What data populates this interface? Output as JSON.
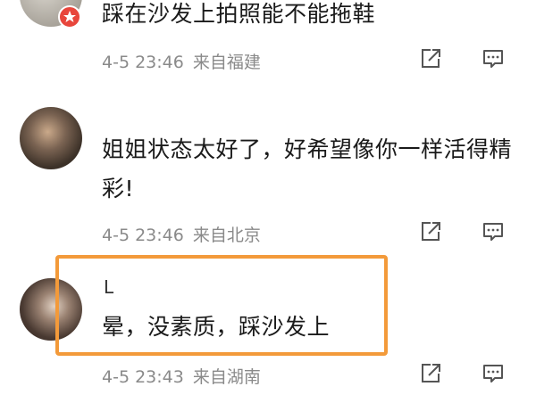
{
  "comments": [
    {
      "text": "踩在沙发上拍照能不能拖鞋",
      "time": "4-5 23:46",
      "location": "来自福建",
      "badge_icon": "star-badge-icon"
    },
    {
      "text_line1": "姐姐状态太好了，好希望像你一样活得精",
      "text_line2": "彩!",
      "time": "4-5 23:46",
      "location": "来自北京"
    },
    {
      "username": "L",
      "text": "晕，没素质，踩沙发上",
      "time": "4-5 23:43",
      "location": "来自湖南"
    }
  ],
  "icons": {
    "share": "share-icon",
    "reply": "comment-icon"
  },
  "colors": {
    "highlight": "#f39a3a",
    "badge": "#e8463c",
    "meta": "#8a8a8a"
  }
}
